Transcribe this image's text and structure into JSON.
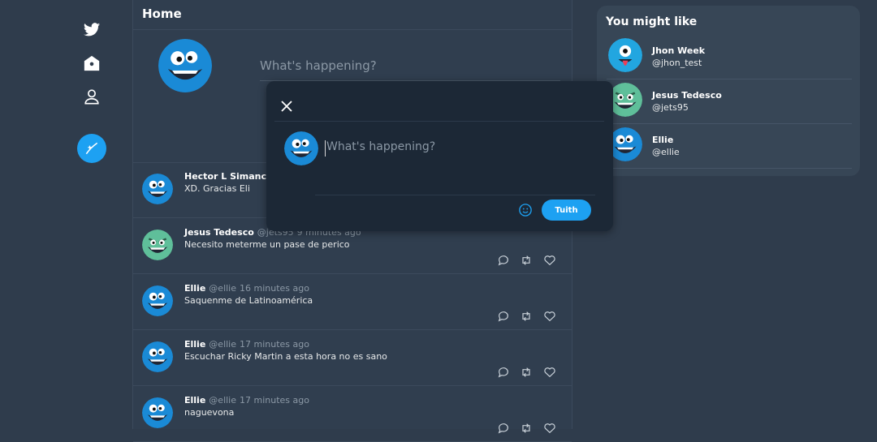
{
  "feed": {
    "title": "Home",
    "composer_placeholder": "What's happening?"
  },
  "tweets": [
    {
      "name": "Hector L Simancas R",
      "handle": "",
      "time": "",
      "text": "XD. Gracias Eli",
      "avatar": "blue-monster"
    },
    {
      "name": "Jesus Tedesco",
      "handle": "@jets95",
      "time": "9 minutes ago",
      "text": "Necesito meterme un pase de perico",
      "avatar": "green-monster"
    },
    {
      "name": "Ellie",
      "handle": "@ellie",
      "time": "16 minutes ago",
      "text": "Saquenme de Latinoamérica",
      "avatar": "blue-monster"
    },
    {
      "name": "Ellie",
      "handle": "@ellie",
      "time": "17 minutes ago",
      "text": "Escuchar Ricky Martin a esta hora no es sano",
      "avatar": "blue-monster"
    },
    {
      "name": "Ellie",
      "handle": "@ellie",
      "time": "17 minutes ago",
      "text": "naguevona",
      "avatar": "blue-monster"
    }
  ],
  "suggestions": {
    "title": "You might like",
    "items": [
      {
        "name": "Jhon Week",
        "handle": "@jhon_test",
        "avatar": "cyclops-monster"
      },
      {
        "name": "Jesus Tedesco",
        "handle": "@jets95",
        "avatar": "green-monster"
      },
      {
        "name": "Ellie",
        "handle": "@ellie",
        "avatar": "blue-monster"
      }
    ]
  },
  "modal": {
    "placeholder": "What's happening?",
    "send_label": "Tuith"
  },
  "colors": {
    "accent": "#1da1f2",
    "background": "#2f3c4c",
    "modal": "#1c2836"
  }
}
